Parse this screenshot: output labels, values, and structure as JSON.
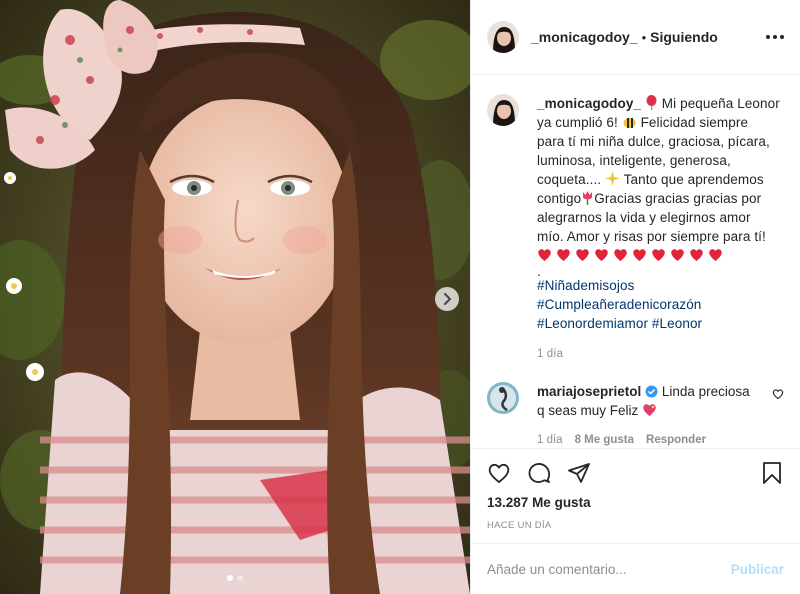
{
  "header": {
    "username": "_monicagodoy_",
    "separator": "•",
    "follow_status": "Siguiendo"
  },
  "caption": {
    "username": "_monicagodoy_",
    "lines": [
      "Mi pequeña Leonor",
      "ya cumplió 6!",
      "Felicidad siempre",
      "para tí mi niña dulce, graciosa, pícara,",
      "luminosa, inteligente, generosa,",
      "coqueta....",
      "Tanto que aprendemos",
      "contigo",
      "Gracias gracias gracias por",
      "alegrarnos la vida y elegirnos amor",
      "mío. Amor y risas por siempre para tí!"
    ],
    "heart_count": 10,
    "dot": ".",
    "hashtags": [
      "#Niñademisojos",
      "#Cumpleañeradenicorazón",
      "#Leonordemiamor #Leonor"
    ],
    "time": "1 día"
  },
  "comment": {
    "username": "mariajoseprietol",
    "text_line1": "Linda preciosa",
    "text_line2": "q seas muy Feliz",
    "time": "1 día",
    "likes": "8 Me gusta",
    "reply": "Responder"
  },
  "likes": {
    "count": "13.287",
    "label": "Me gusta"
  },
  "posted": "Hace un día",
  "add_comment": {
    "placeholder": "Añade un comentario...",
    "publish": "Publicar"
  },
  "carousel": {
    "current": 1,
    "total": 2
  },
  "colors": {
    "link": "#00376b",
    "muted": "#8e8e8e",
    "publish_disabled": "#b2dffc",
    "heart": "#e0243a",
    "verified": "#3897f0"
  },
  "icons": [
    "more-options-icon",
    "heart-icon",
    "comment-icon",
    "share-icon",
    "bookmark-icon",
    "chevron-right-icon",
    "verified-badge-icon"
  ]
}
